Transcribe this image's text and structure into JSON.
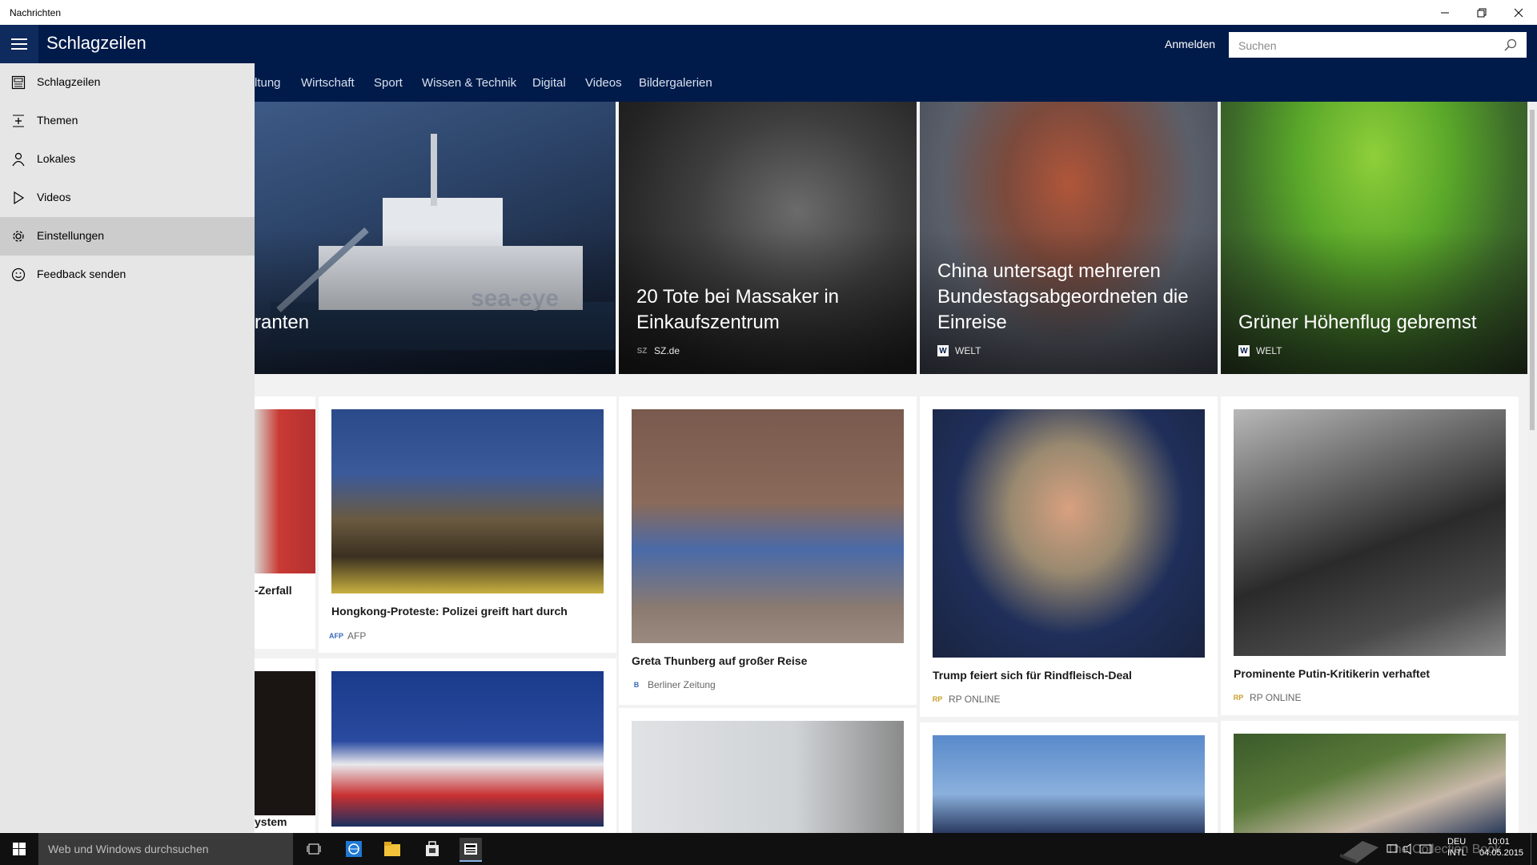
{
  "window": {
    "title": "Nachrichten"
  },
  "header": {
    "title": "Schlagzeilen",
    "signin_label": "Anmelden",
    "search_placeholder": "Suchen"
  },
  "categories": [
    "ltung",
    "Wirtschaft",
    "Sport",
    "Wissen & Technik",
    "Digital",
    "Videos",
    "Bildergalerien"
  ],
  "menu": {
    "items": [
      {
        "label": "Schlagzeilen",
        "icon": "news-icon"
      },
      {
        "label": "Themen",
        "icon": "topics-icon"
      },
      {
        "label": "Lokales",
        "icon": "person-icon"
      },
      {
        "label": "Videos",
        "icon": "play-icon"
      },
      {
        "label": "Einstellungen",
        "icon": "gear-icon",
        "selected": true
      },
      {
        "label": "Feedback senden",
        "icon": "smiley-icon"
      }
    ]
  },
  "hero": [
    {
      "title": "ranten",
      "source": ""
    },
    {
      "title": "20 Tote bei Massaker in Einkaufszentrum",
      "source": "SZ.de",
      "source_logo": "SZ"
    },
    {
      "title": "China untersagt mehreren Bundestagsabgeordneten die Einreise",
      "source": "WELT",
      "source_logo": "W"
    },
    {
      "title": "Grüner Höhenflug gebremst",
      "source": "WELT",
      "source_logo": "W"
    }
  ],
  "cards": [
    {
      "title": "-Zerfall",
      "source": ""
    },
    {
      "title": "Hongkong-Proteste: Polizei greift hart durch",
      "source": "AFP",
      "source_logo": "AFP"
    },
    {
      "title": "Greta Thunberg auf großer Reise",
      "source": "Berliner Zeitung",
      "source_logo": "B"
    },
    {
      "title": "Trump feiert sich für Rindfleisch-Deal",
      "source": "RP ONLINE",
      "source_logo": "RP"
    },
    {
      "title": "Prominente Putin-Kritikerin verhaftet",
      "source": "RP ONLINE",
      "source_logo": "RP"
    },
    {
      "title": "ystem",
      "source": ""
    }
  ],
  "taskbar": {
    "search_placeholder": "Web und Windows durchsuchen",
    "lang_top": "DEU",
    "lang_bottom": "INTL",
    "time": "10:01",
    "date": "04.05.2015"
  },
  "watermark": "The Collection Book",
  "colors": {
    "header_bg": "#001b4a",
    "menu_bg": "#e6e6e6",
    "menu_selected": "#cccccc",
    "taskbar_bg": "#101010"
  }
}
